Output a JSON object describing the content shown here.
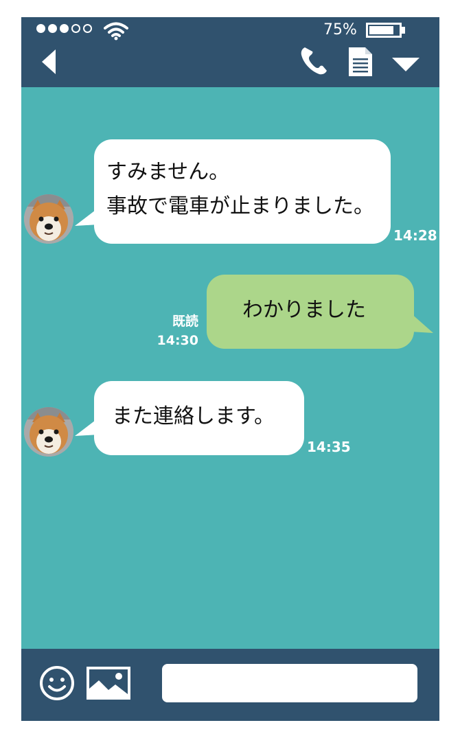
{
  "status_bar": {
    "signal_strength": 3,
    "signal_max": 5,
    "battery_percent_label": "75%",
    "battery_level": 0.75
  },
  "header": {
    "icons": [
      "back-arrow-icon",
      "phone-icon",
      "document-icon",
      "dropdown-icon"
    ]
  },
  "messages": [
    {
      "direction": "incoming",
      "text": "すみません。\n事故で電車が止まりました。",
      "time": "14:28",
      "avatar": "shiba-dog-avatar"
    },
    {
      "direction": "outgoing",
      "text": "わかりました",
      "read_label": "既読",
      "time": "14:30"
    },
    {
      "direction": "incoming",
      "text": "また連絡します。",
      "time": "14:35",
      "avatar": "shiba-dog-avatar"
    }
  ],
  "composer": {
    "icons": [
      "smiley-icon",
      "image-icon"
    ],
    "input_value": "",
    "input_placeholder": ""
  },
  "colors": {
    "chat_background": "#4db4b4",
    "bar_background": "#30526e",
    "incoming_bubble": "#ffffff",
    "outgoing_bubble": "#acd68a"
  }
}
